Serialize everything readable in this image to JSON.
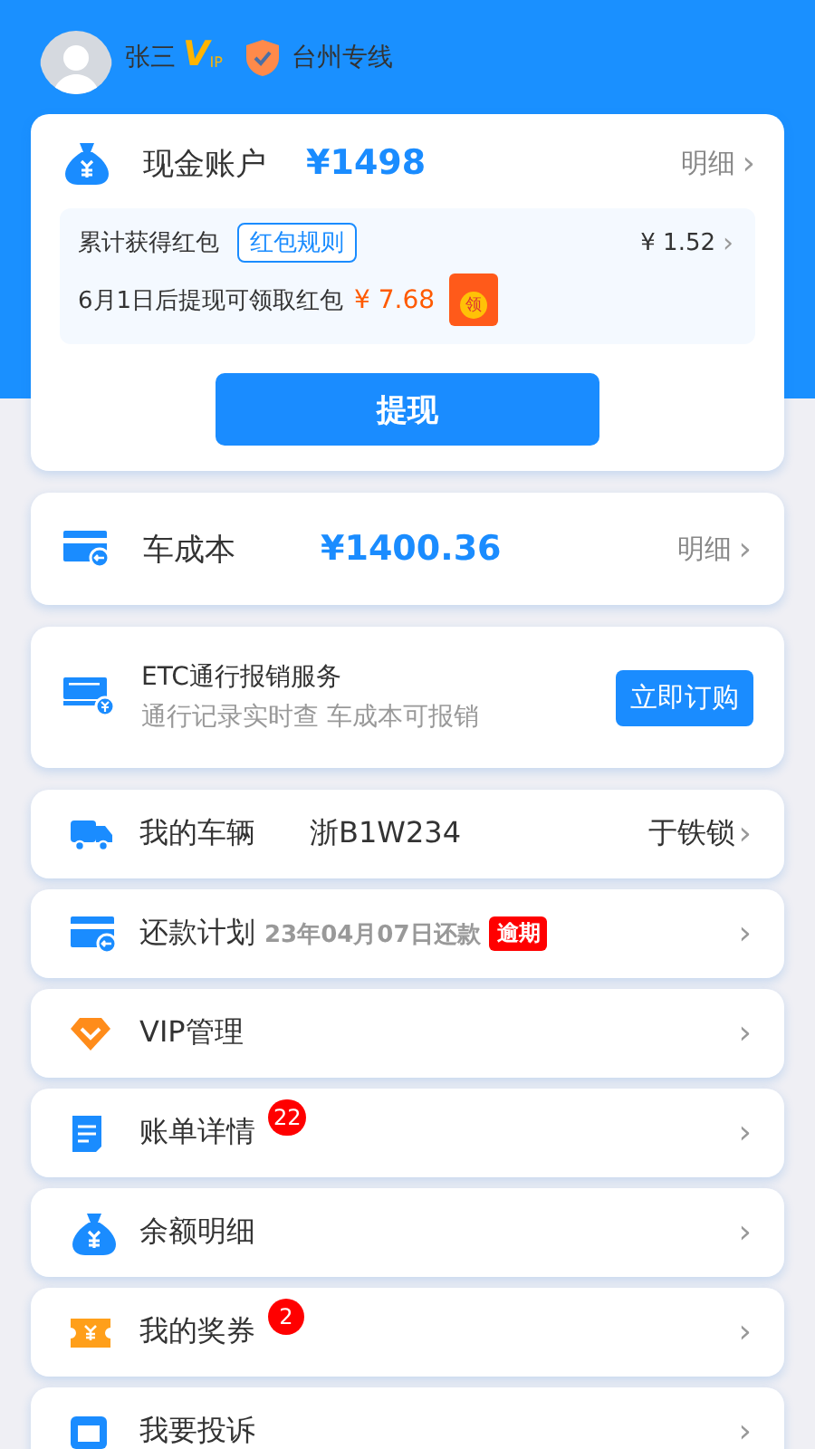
{
  "user": {
    "name": "张三",
    "vip_label": "V",
    "vip_sub": "IP",
    "line": "台州专线"
  },
  "cash_account": {
    "title": "现金账户",
    "amount": "¥1498",
    "link": "明细",
    "chevron": "›",
    "redpacket": {
      "label": "累计获得红包",
      "rules": "红包规则",
      "total": "¥ 1.52",
      "chevron": "›",
      "note": "6月1日后提现可领取红包",
      "pending": "¥ 7.68",
      "packet_glyph": "领"
    },
    "withdraw": "提现"
  },
  "car_cost": {
    "title": "车成本",
    "amount": "¥1400.36",
    "link": "明细",
    "chevron": "›"
  },
  "etc": {
    "title": "ETC通行报销服务",
    "subtitle": "通行记录实时查 车成本可报销",
    "button": "立即订购"
  },
  "menu": [
    {
      "label": "我的车辆",
      "value": "浙B1W234",
      "right": "于铁锁",
      "chevron": "›"
    },
    {
      "label": "还款计划",
      "date": "23年04月07日还款",
      "tag": "逾期",
      "chevron": "›"
    },
    {
      "label": "VIP管理",
      "chevron": "›"
    },
    {
      "label": "账单详情",
      "badge": "22",
      "chevron": "›"
    },
    {
      "label": "余额明细",
      "chevron": "›"
    },
    {
      "label": "我的奖券",
      "badge": "2",
      "chevron": "›"
    },
    {
      "label": "我要投诉",
      "chevron": "›"
    }
  ]
}
